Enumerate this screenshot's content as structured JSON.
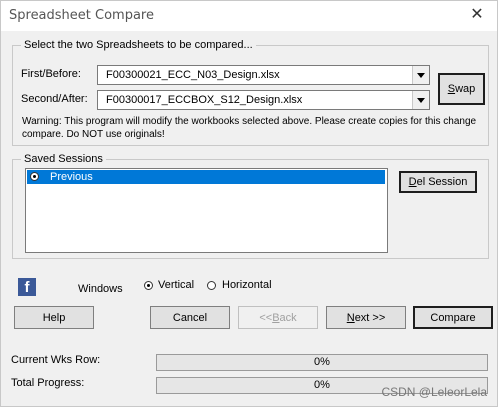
{
  "window": {
    "title": "Spreadsheet Compare",
    "close_glyph": "✕"
  },
  "select_group": {
    "legend": "Select the two Spreadsheets to be compared...",
    "first_label": "First/Before:",
    "first_value": "F00300021_ECC_N03_Design.xlsx",
    "second_label": "Second/After:",
    "second_value": "F00300017_ECCBOX_S12_Design.xlsx",
    "swap_label": "Swap",
    "warning": "Warning: This program will modify the workbooks selected above. Please create copies for this change compare. Do NOT use originals!"
  },
  "sessions": {
    "legend": "Saved Sessions",
    "items": [
      {
        "label": "Previous",
        "selected": true
      }
    ],
    "del_label": "Del Session"
  },
  "layout_options": {
    "icon": "facebook-icon",
    "windows_label": "Windows",
    "vertical_label": "Vertical",
    "horizontal_label": "Horizontal",
    "selected": "Vertical"
  },
  "buttons": {
    "help": "Help",
    "cancel": "Cancel",
    "back": "<< Back",
    "next": "Next >>",
    "compare": "Compare"
  },
  "progress": {
    "row_label": "Current Wks Row:",
    "row_value": "0%",
    "row_fraction": 0,
    "total_label": "Total Progress:",
    "total_value": "0%",
    "total_fraction": 0
  },
  "watermark": "CSDN @LeleorLela",
  "colors": {
    "selection": "#0078d7",
    "facebook": "#3b5998",
    "progress_fill": "#06b025"
  }
}
